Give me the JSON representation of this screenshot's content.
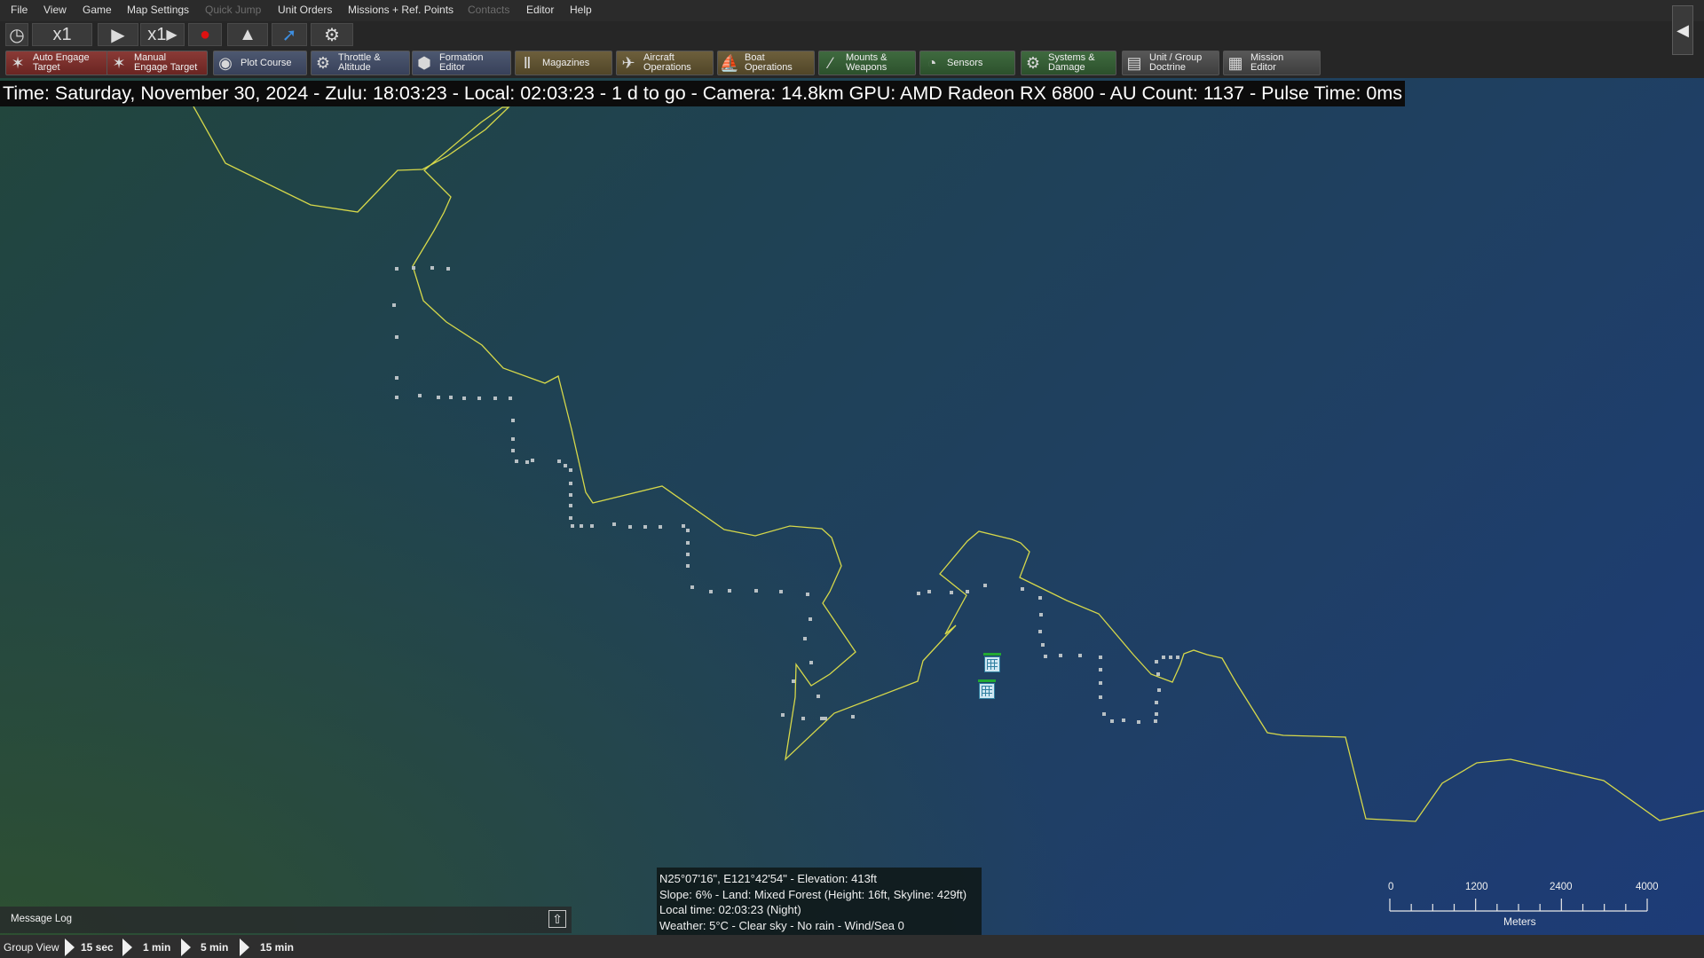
{
  "menu": [
    "File",
    "View",
    "Game",
    "Map Settings",
    "Quick Jump",
    "Unit Orders",
    "Missions + Ref. Points",
    "Contacts",
    "Editor",
    "Help"
  ],
  "disabled_menu": [
    "Quick Jump",
    "Contacts"
  ],
  "time_controls": {
    "clock_icon": "clock-icon",
    "speed_label": "x1",
    "play_icon": "play-icon",
    "step_label": "x1",
    "step_icon": "step-forward-icon",
    "record_icon": "record-icon",
    "camera_icon": "camera-icon",
    "tool_icon": "pointer-icon",
    "settings_icon": "gear-icon"
  },
  "toolbar": [
    {
      "label": "Auto Engage\nTarget",
      "icon": "crosshair-icon",
      "style": "red"
    },
    {
      "label": "Manual\nEngage Target",
      "icon": "crosshair-icon",
      "style": "red"
    },
    {
      "label": "Plot Course",
      "icon": "compass-icon",
      "style": "blue"
    },
    {
      "label": "Throttle &\nAltitude",
      "icon": "gauge-icon",
      "style": "blue"
    },
    {
      "label": "Formation\nEditor",
      "icon": "formation-icon",
      "style": "blue"
    },
    {
      "label": "Magazines",
      "icon": "ammo-icon",
      "style": "gold"
    },
    {
      "label": "Aircraft\nOperations",
      "icon": "aircraft-icon",
      "style": "gold"
    },
    {
      "label": "Boat\nOperations",
      "icon": "boat-icon",
      "style": "gold"
    },
    {
      "label": "Mounts &\nWeapons",
      "icon": "missile-icon",
      "style": "green"
    },
    {
      "label": "Sensors",
      "icon": "radar-icon",
      "style": "green"
    },
    {
      "label": "Systems &\nDamage",
      "icon": "gear-icon",
      "style": "green"
    },
    {
      "label": "Unit / Group\nDoctrine",
      "icon": "document-icon",
      "style": "grey"
    },
    {
      "label": "Mission\nEditor",
      "icon": "editor-icon",
      "style": "grey"
    }
  ],
  "status_line": "Time: Saturday, November 30, 2024 - Zulu: 18:03:23 - Local: 02:03:23 - 1 d to go - Camera: 14.8km GPU: AMD Radeon RX 6800 - AU Count: 1137 - Pulse Time: 0ms",
  "info_box": [
    "N25°07'16\", E121°42'54\" - Elevation: 413ft",
    "Slope: 6%  - Land: Mixed Forest (Height: 16ft, Skyline: 429ft)",
    "Local time: 02:03:23 (Night)",
    "Weather: 5°C - Clear sky - No rain - Wind/Sea 0"
  ],
  "message_log": {
    "label": "Message Log",
    "button_icon": "expand-up-icon"
  },
  "bottom_bar": {
    "view_label": "Group View",
    "steps": [
      "15 sec",
      "1 min",
      "5 min",
      "15 min"
    ]
  },
  "scale_bar": {
    "ticks": [
      "0",
      "1200",
      "2400",
      "4000"
    ],
    "unit": "Meters"
  },
  "units": [
    {
      "name": "facility-unit-1"
    },
    {
      "name": "facility-unit-2"
    }
  ],
  "colors": {
    "coastline": "#d6d84a",
    "boundary_dots": "#b8c0c4",
    "unit_green": "#22aa33"
  }
}
